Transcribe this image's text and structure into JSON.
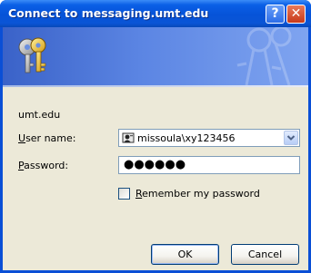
{
  "window": {
    "title": "Connect to messaging.umt.edu",
    "help_glyph": "?",
    "close_glyph": "✕"
  },
  "banner": {
    "icon": "keys-icon"
  },
  "server": "umt.edu",
  "username": {
    "label_first": "U",
    "label_rest": "ser name:",
    "value": "missoula\\xy123456",
    "icon": "user-card-icon"
  },
  "password": {
    "label_first": "P",
    "label_rest": "assword:",
    "masked_value": "●●●●●●"
  },
  "remember": {
    "label_first": "R",
    "label_rest": "emember my password",
    "checked": false
  },
  "buttons": {
    "ok": "OK",
    "cancel": "Cancel"
  },
  "colors": {
    "titlebar": "#0653d8",
    "client": "#ece9d8",
    "close": "#c8391a"
  }
}
